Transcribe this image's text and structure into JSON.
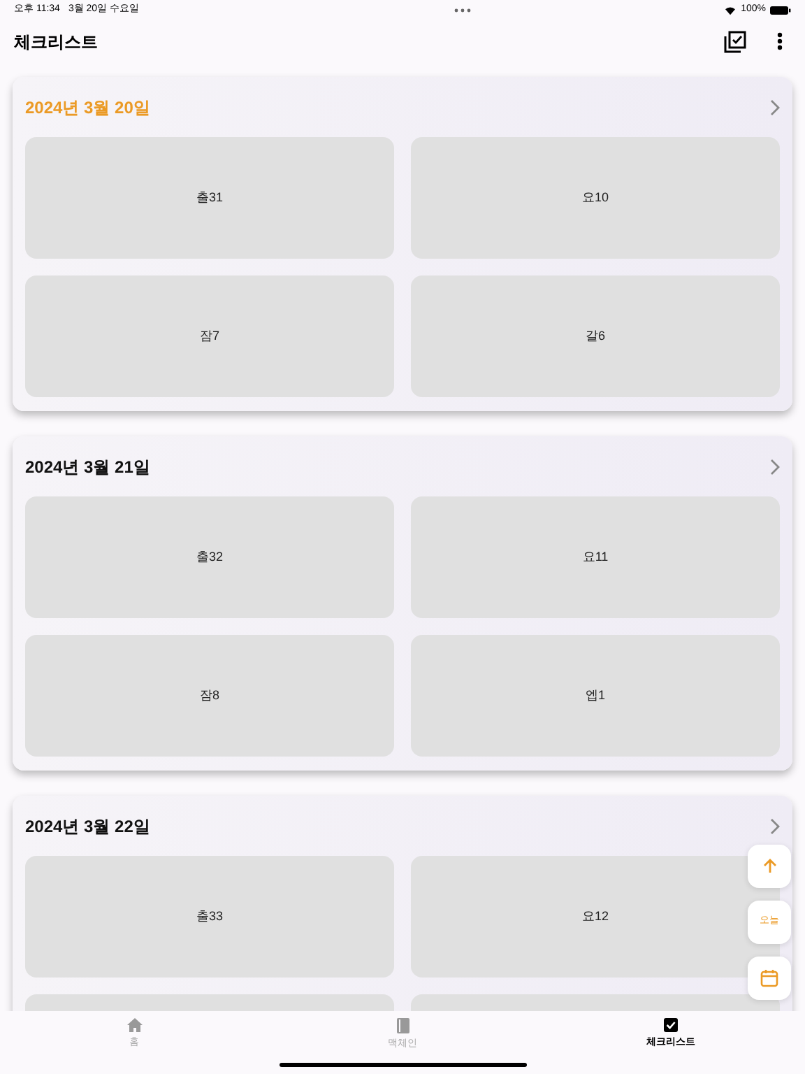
{
  "status_bar": {
    "time": "오후 11:34",
    "date": "3월 20일 수요일",
    "battery": "100%"
  },
  "header": {
    "title": "체크리스트"
  },
  "days": [
    {
      "date": "2024년 3월 20일",
      "today": true,
      "items": [
        {
          "label": "출31"
        },
        {
          "label": "요10"
        },
        {
          "label": "잠7"
        },
        {
          "label": "갈6"
        }
      ]
    },
    {
      "date": "2024년 3월 21일",
      "today": false,
      "items": [
        {
          "label": "출32"
        },
        {
          "label": "요11"
        },
        {
          "label": "잠8"
        },
        {
          "label": "엡1"
        }
      ]
    },
    {
      "date": "2024년 3월 22일",
      "today": false,
      "items": [
        {
          "kind": "tile",
          "label": "출33"
        },
        {
          "kind": "tile",
          "label": "요12"
        },
        {
          "kind": "partial"
        },
        {
          "kind": "partial"
        }
      ]
    }
  ],
  "floating": {
    "today_label": "오늘"
  },
  "tabs": [
    {
      "label": "홈",
      "selected": false
    },
    {
      "label": "맥체인",
      "selected": false
    },
    {
      "label": "체크리스트",
      "selected": true
    }
  ]
}
